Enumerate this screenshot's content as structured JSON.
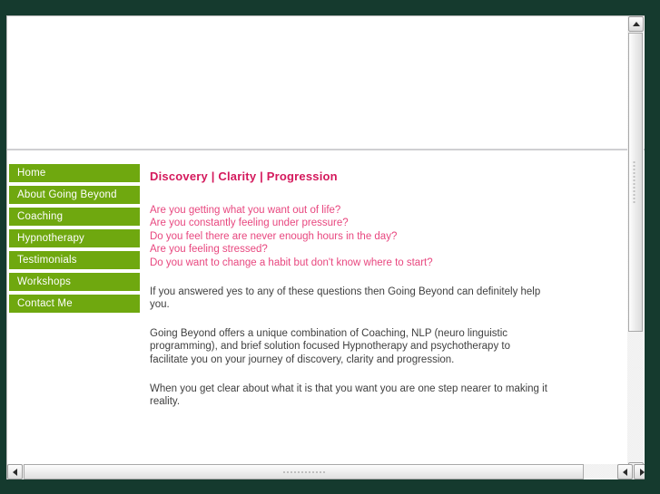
{
  "window": {
    "brand_dark_green": "#153a2e",
    "page_background": "#ffffff"
  },
  "masthead": {
    "label": "",
    "description": "empty banner area"
  },
  "sidebar": {
    "accent_color": "#6fa80f",
    "items": [
      {
        "label": "Home",
        "name": "home"
      },
      {
        "label": "About Going Beyond",
        "name": "about-going-beyond"
      },
      {
        "label": "Coaching",
        "name": "coaching"
      },
      {
        "label": "Hypnotherapy",
        "name": "hypnotherapy"
      },
      {
        "label": "Testimonials",
        "name": "testimonials"
      },
      {
        "label": "Workshops",
        "name": "workshops"
      },
      {
        "label": "Contact Me",
        "name": "contact-me"
      }
    ]
  },
  "main": {
    "heading": "Discovery | Clarity | Progression",
    "heading_color": "#d4195c",
    "question_color": "#e8477f",
    "questions": [
      "Are you getting what you want out of life?",
      "Are you constantly feeling under pressure?",
      "Do you feel there are never enough hours in the day?",
      "Are you feeling stressed?",
      "Do you want to change a habit but don't know where to start?"
    ],
    "paragraphs": [
      "If you answered yes to any of these questions then Going Beyond can definitely help you.",
      "Going Beyond offers a unique combination of Coaching, NLP (neuro linguistic programming), and brief solution focused Hypnotherapy and psychotherapy to facilitate you on your journey of discovery, clarity and progression.",
      "When you get clear about what it is that you want you are one step nearer to making it reality."
    ]
  },
  "scrollbars": {
    "vertical": {
      "up_icon": "scroll-up-icon",
      "down_icon": "scroll-down-icon",
      "grip_icon": "grip-icon"
    },
    "horizontal": {
      "left_icon": "scroll-left-icon",
      "right_icon": "scroll-right-icon",
      "grip_icon": "grip-icon"
    }
  }
}
